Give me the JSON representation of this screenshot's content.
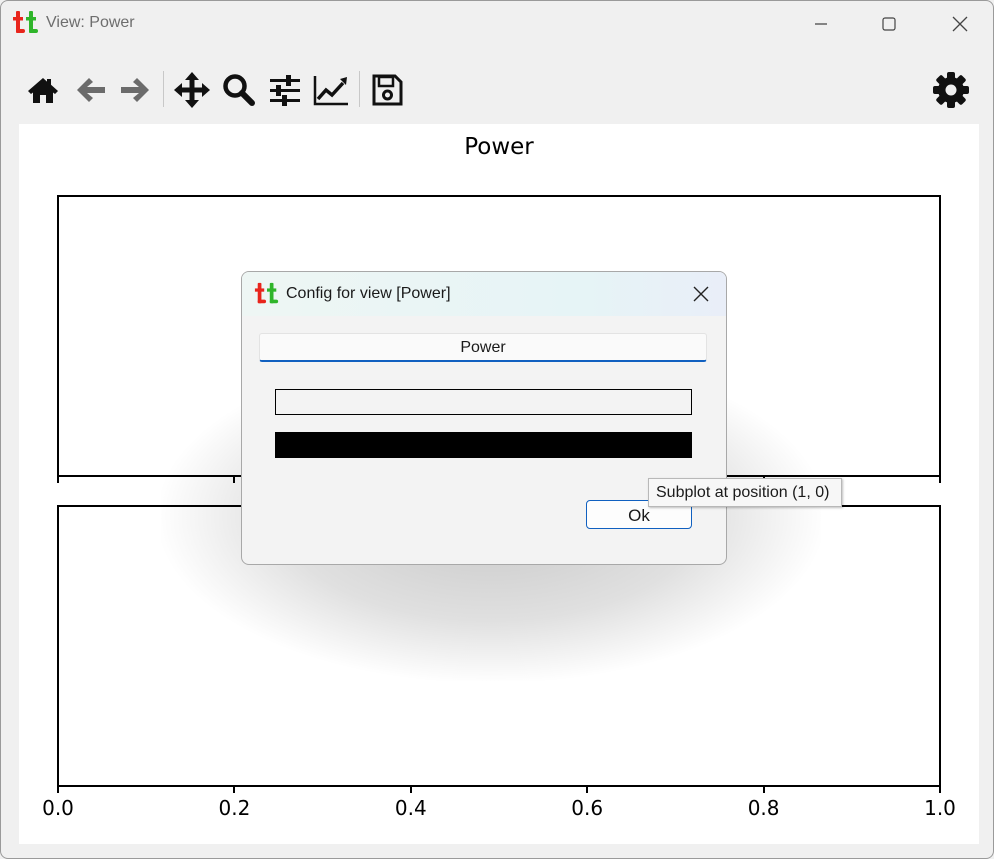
{
  "window": {
    "title": "View: Power",
    "logo": "tt-logo",
    "controls": [
      "minimize-icon",
      "maximize-icon",
      "close-icon"
    ]
  },
  "toolbar": {
    "items": [
      "home-icon",
      "back-arrow-icon",
      "forward-arrow-icon",
      "pan-icon",
      "zoom-icon",
      "subplots-config-icon",
      "axes-edit-icon",
      "save-icon"
    ],
    "settings_icon": "gear-icon"
  },
  "figure": {
    "title": "Power",
    "x_ticks": [
      "0.0",
      "0.2",
      "0.4",
      "0.6",
      "0.8",
      "1.0"
    ]
  },
  "chart_data": {
    "type": "line",
    "title": "Power",
    "subplots": 2,
    "xlim": [
      0.0,
      1.0
    ],
    "x_tick_labels": [
      "0.0",
      "0.2",
      "0.4",
      "0.6",
      "0.8",
      "1.0"
    ],
    "series": []
  },
  "dialog": {
    "title": "Config for view [Power]",
    "name_value": "Power",
    "ok_label": "Ok"
  },
  "tooltip": {
    "text": "Subplot at position (1, 0)"
  },
  "colors": {
    "logo_t1": "#e8251c",
    "logo_t2": "#2fb52a",
    "focus_blue": "#1060c0"
  }
}
